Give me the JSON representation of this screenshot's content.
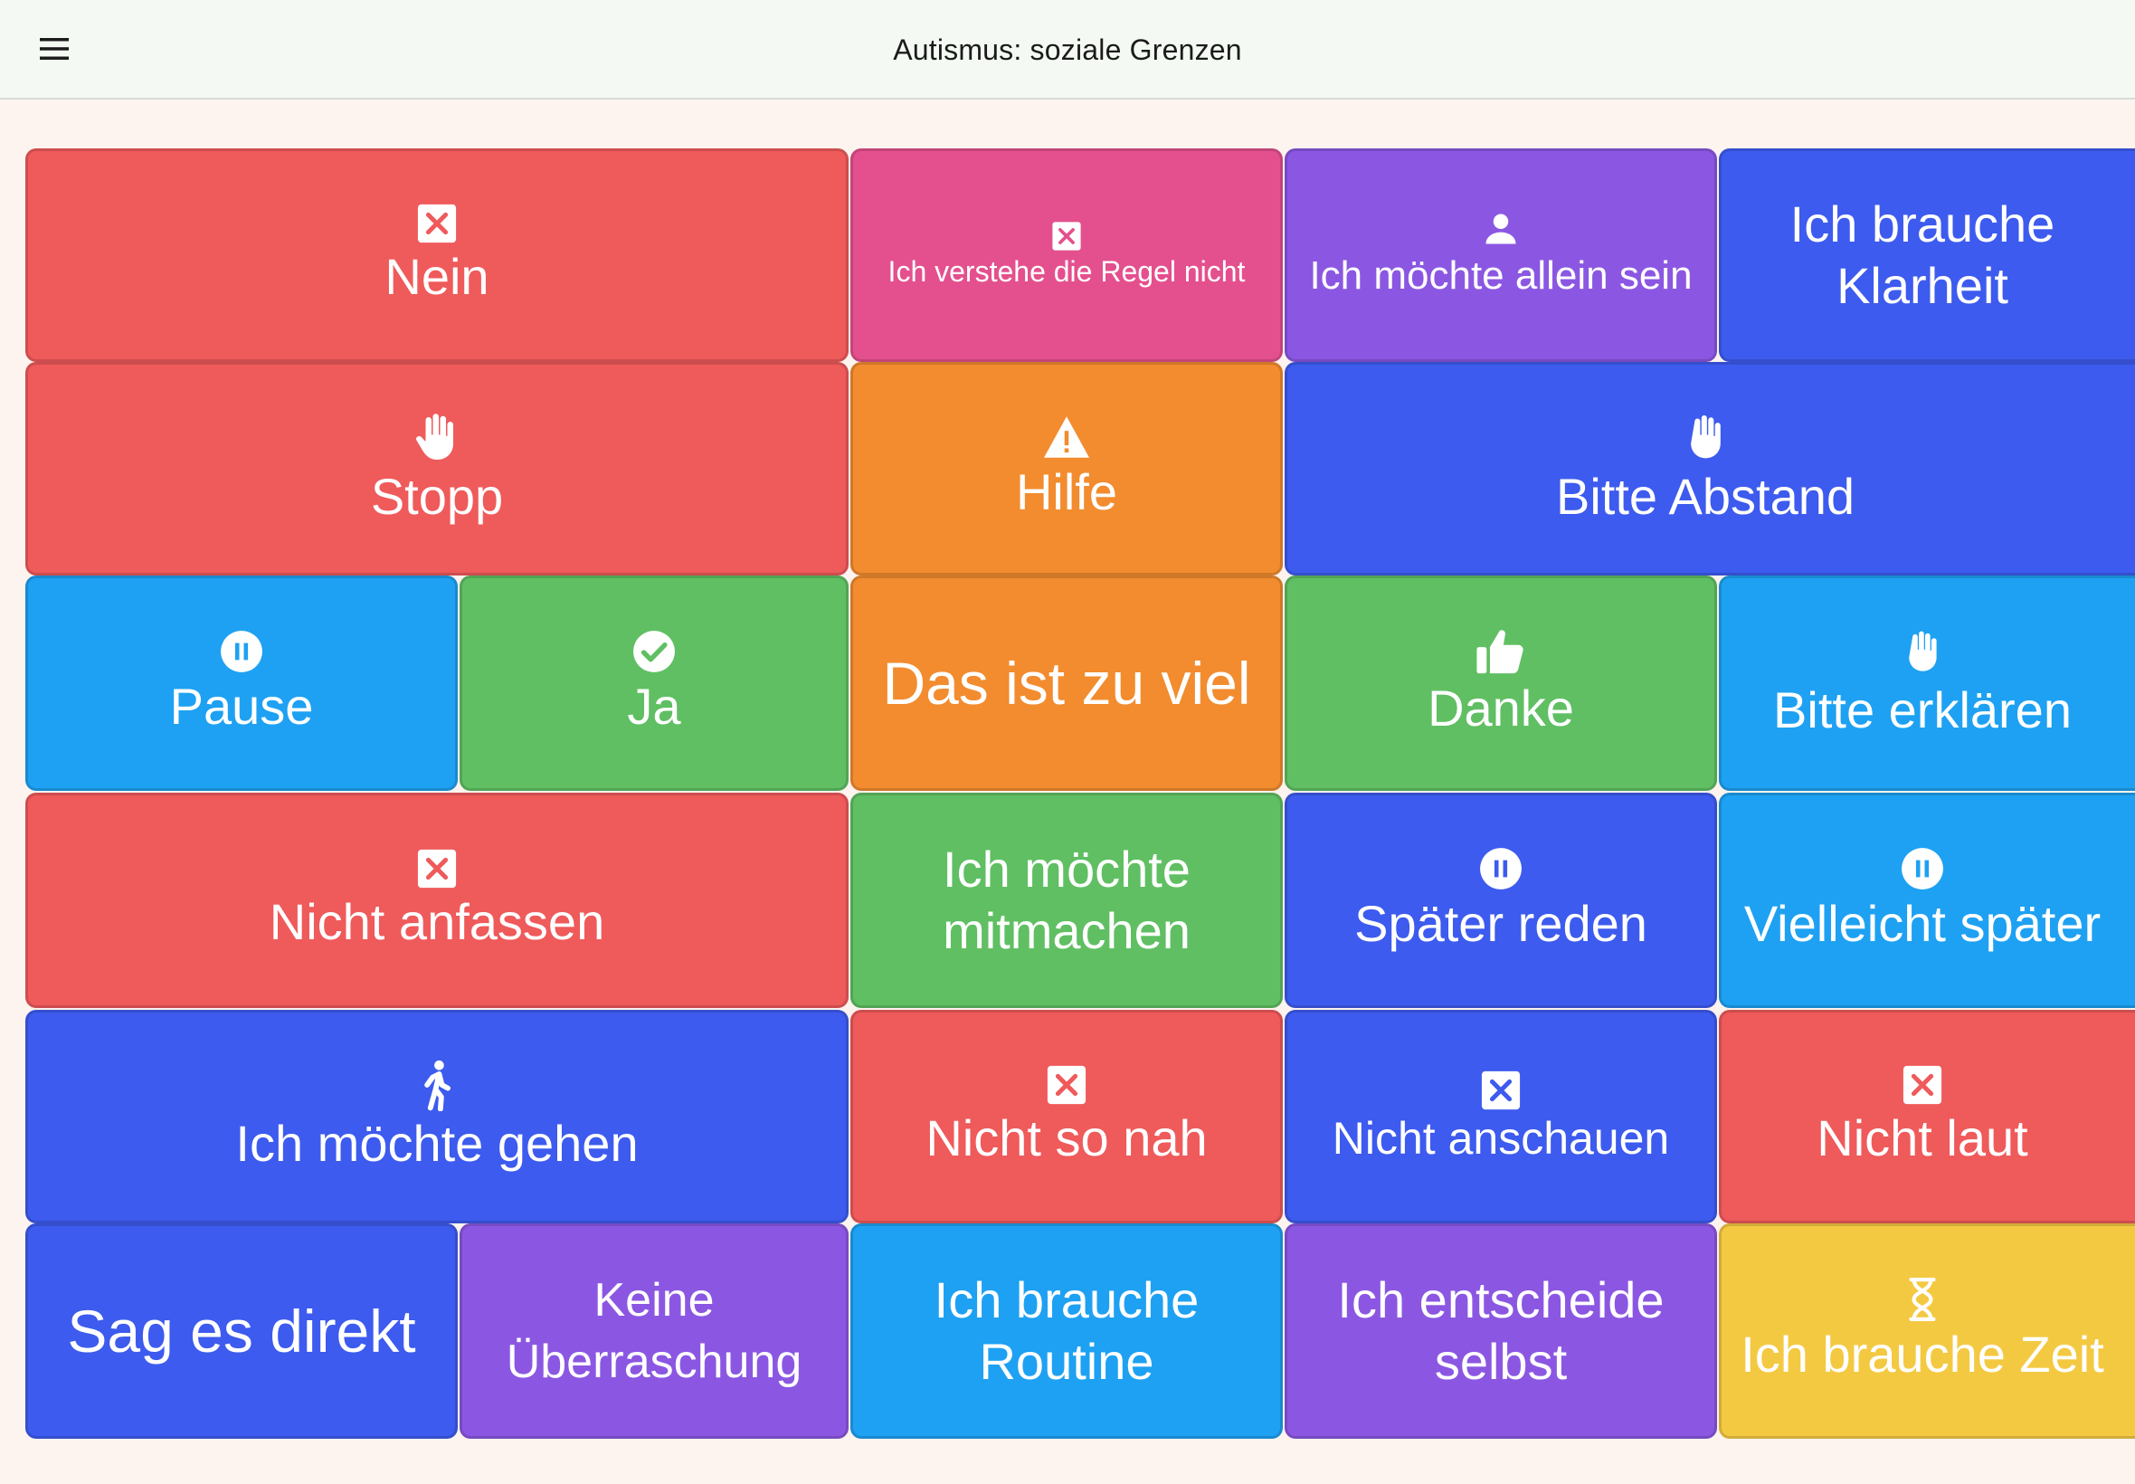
{
  "app": {
    "title": "Autismus: soziale Grenzen",
    "menu_icon": "menu-icon"
  },
  "colors": {
    "red": "#ef5a5b",
    "pink": "#e4508e",
    "purple": "#8b57e2",
    "blue": "#3d5bee",
    "orange": "#f28c2f",
    "cyan": "#1ea1f2",
    "green": "#60bf63",
    "yellow": "#f4c942",
    "background": "#fdf3ef",
    "appbar": "#f4faf3"
  },
  "tiles": [
    {
      "label": "Nein",
      "icon": "close-box-icon",
      "color": "red"
    },
    {
      "label": "Ich verstehe die Regel nicht",
      "icon": "close-box-icon",
      "color": "pink"
    },
    {
      "label": "Ich möchte allein sein",
      "icon": "person-icon",
      "color": "purple"
    },
    {
      "label": "Ich brauche Klarheit",
      "icon": "",
      "color": "blue"
    },
    {
      "label": "Stopp",
      "icon": "hand-icon",
      "color": "red"
    },
    {
      "label": "Hilfe",
      "icon": "warning-icon",
      "color": "orange"
    },
    {
      "label": "Bitte Abstand",
      "icon": "hand-icon",
      "color": "blue"
    },
    {
      "label": "Pause",
      "icon": "pause-circle-icon",
      "color": "cyan"
    },
    {
      "label": "Ja",
      "icon": "check-circle-icon",
      "color": "green"
    },
    {
      "label": "Das ist zu viel",
      "icon": "",
      "color": "orange"
    },
    {
      "label": "Danke",
      "icon": "thumbs-up-icon",
      "color": "green"
    },
    {
      "label": "Bitte erklären",
      "icon": "hand-icon",
      "color": "cyan"
    },
    {
      "label": "Nicht anfassen",
      "icon": "close-box-icon",
      "color": "red"
    },
    {
      "label": "Ich möchte mitmachen",
      "icon": "",
      "color": "green"
    },
    {
      "label": "Später reden",
      "icon": "pause-circle-icon",
      "color": "blue"
    },
    {
      "label": "Vielleicht später",
      "icon": "pause-circle-icon",
      "color": "cyan"
    },
    {
      "label": "Ich möchte gehen",
      "icon": "walk-icon",
      "color": "blue"
    },
    {
      "label": "Nicht so nah",
      "icon": "close-box-icon",
      "color": "red"
    },
    {
      "label": "Nicht anschauen",
      "icon": "close-box-icon",
      "color": "blue"
    },
    {
      "label": "Nicht laut",
      "icon": "close-box-icon",
      "color": "red"
    },
    {
      "label": "Sag es direkt",
      "icon": "",
      "color": "blue"
    },
    {
      "label": "Keine Überraschung",
      "icon": "",
      "color": "purple"
    },
    {
      "label": "Ich brauche Routine",
      "icon": "",
      "color": "cyan"
    },
    {
      "label": "Ich entscheide selbst",
      "icon": "",
      "color": "purple"
    },
    {
      "label": "Ich brauche Zeit",
      "icon": "hourglass-icon",
      "color": "yellow"
    }
  ]
}
